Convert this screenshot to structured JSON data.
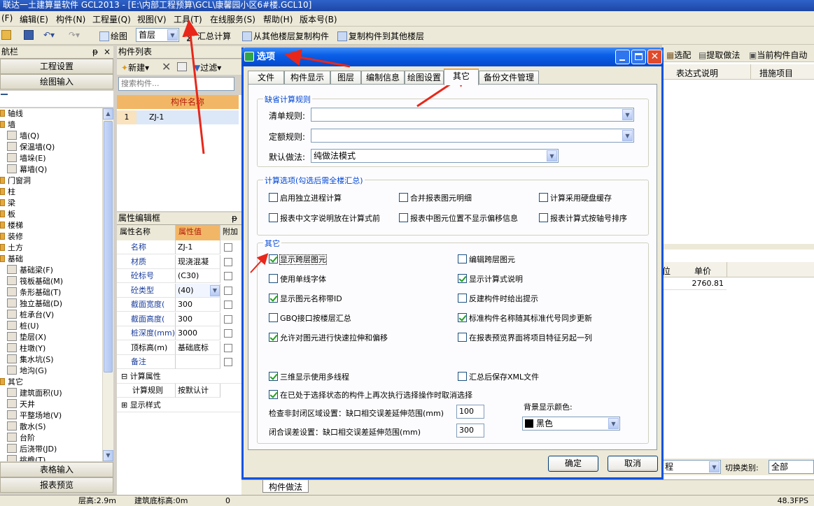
{
  "app": {
    "title": "联达一土建算量软件 GCL2013 - [E:\\内部工程预算\\GCL\\康馨园小区6#楼.GCL10]"
  },
  "menu": [
    "(F)",
    "编辑(E)",
    "构件(N)",
    "工程量(Q)",
    "视图(V)",
    "工具(T)",
    "在线服务(S)",
    "帮助(H)",
    "版本号(B)"
  ],
  "toolbar": {
    "draw_label": "绘图",
    "floor_value": "首层",
    "sum_calc": "汇总计算",
    "copy_from_floors": "从其他楼层复制构件",
    "copy_to_floors": "复制构件到其他楼层"
  },
  "nav": {
    "title": "航栏",
    "project_settings": "工程设置",
    "drawing_input": "绘图输入",
    "table_input": "表格输入",
    "report_preview": "报表预览",
    "tree": [
      {
        "label": "轴线",
        "type": "folder",
        "indent": 0
      },
      {
        "label": "墙",
        "type": "folder",
        "indent": 0
      },
      {
        "label": "墙(Q)",
        "type": "item",
        "indent": 1
      },
      {
        "label": "保温墙(Q)",
        "type": "item",
        "indent": 1
      },
      {
        "label": "墙垛(E)",
        "type": "item",
        "indent": 1
      },
      {
        "label": "幕墙(Q)",
        "type": "item",
        "indent": 1
      },
      {
        "label": "门窗洞",
        "type": "folder",
        "indent": 0
      },
      {
        "label": "柱",
        "type": "folder",
        "indent": 0
      },
      {
        "label": "梁",
        "type": "folder",
        "indent": 0
      },
      {
        "label": "板",
        "type": "folder",
        "indent": 0
      },
      {
        "label": "楼梯",
        "type": "folder",
        "indent": 0
      },
      {
        "label": "装修",
        "type": "folder",
        "indent": 0
      },
      {
        "label": "土方",
        "type": "folder",
        "indent": 0
      },
      {
        "label": "基础",
        "type": "folder",
        "indent": 0
      },
      {
        "label": "基础梁(F)",
        "type": "item",
        "indent": 1
      },
      {
        "label": "筏板基础(M)",
        "type": "item",
        "indent": 1
      },
      {
        "label": "条形基础(T)",
        "type": "item",
        "indent": 1
      },
      {
        "label": "独立基础(D)",
        "type": "item",
        "indent": 1
      },
      {
        "label": "桩承台(V)",
        "type": "item",
        "indent": 1
      },
      {
        "label": "桩(U)",
        "type": "item",
        "indent": 1
      },
      {
        "label": "垫层(X)",
        "type": "item",
        "indent": 1
      },
      {
        "label": "柱墩(Y)",
        "type": "item",
        "indent": 1
      },
      {
        "label": "集水坑(S)",
        "type": "item",
        "indent": 1
      },
      {
        "label": "地沟(G)",
        "type": "item",
        "indent": 1
      },
      {
        "label": "其它",
        "type": "folder",
        "indent": 0
      },
      {
        "label": "建筑面积(U)",
        "type": "item",
        "indent": 1
      },
      {
        "label": "天井",
        "type": "item",
        "indent": 1
      },
      {
        "label": "平整场地(V)",
        "type": "item",
        "indent": 1
      },
      {
        "label": "散水(S)",
        "type": "item",
        "indent": 1
      },
      {
        "label": "台阶",
        "type": "item",
        "indent": 1
      },
      {
        "label": "后浇带(JD)",
        "type": "item",
        "indent": 1
      },
      {
        "label": "挑檐(T)",
        "type": "item",
        "indent": 1
      }
    ]
  },
  "component_list": {
    "title": "构件列表",
    "new_label": "新建",
    "filter_label": "过滤",
    "search_placeholder": "搜索构件...",
    "column_header": "构件名称",
    "rows": [
      {
        "index": "1",
        "name": "ZJ-1"
      }
    ]
  },
  "property_editor": {
    "title": "属性编辑框",
    "col_name": "属性名称",
    "col_value": "属性值",
    "col_extra": "附加",
    "rows": [
      {
        "name": "名称",
        "value": "ZJ-1"
      },
      {
        "name": "材质",
        "value": "现浇混凝"
      },
      {
        "name": "砼标号",
        "value": "(C30)"
      },
      {
        "name": "砼类型",
        "value": "(40)"
      },
      {
        "name": "截面宽度(",
        "value": "300"
      },
      {
        "name": "截面高度(",
        "value": "300"
      },
      {
        "name": "桩深度(mm)",
        "value": "3000"
      },
      {
        "name": "顶标高(m)",
        "value": "基础底标"
      },
      {
        "name": "备注",
        "value": ""
      },
      {
        "name": "计算属性",
        "value": ""
      },
      {
        "name": "计算规则",
        "value": "按默认计"
      },
      {
        "name": "显示样式",
        "value": ""
      }
    ]
  },
  "right_panel": {
    "select_config": "选配",
    "extract_method": "提取做法",
    "auto_current": "当前构件自动",
    "col_expr_desc": "表达式说明",
    "col_measure": "措施项目",
    "col_b": "位",
    "col_unit_price": "单价",
    "unit_price_value": "2760.81",
    "bottom_combo": "程",
    "switch_label": "切换类别:",
    "switch_value": "全部",
    "bottom_tab": "构件做法"
  },
  "dialog": {
    "title": "选项",
    "tabs": [
      "文件",
      "构件显示",
      "图层",
      "编制信息",
      "绘图设置",
      "其它",
      "备份文件管理"
    ],
    "active_tab": "其它",
    "group_default_rules": "缺省计算规则",
    "list_rule_label": "清单规则:",
    "list_rule_value": "",
    "quota_rule_label": "定额规则:",
    "quota_rule_value": "",
    "default_method_label": "默认做法:",
    "default_method_value": "纯做法模式",
    "group_calc_options": "计算选项(勾选后需全楼汇总)",
    "calc_options": [
      {
        "label": "启用独立进程计算",
        "checked": false
      },
      {
        "label": "合并报表图元明细",
        "checked": false
      },
      {
        "label": "计算采用硬盘缓存",
        "checked": false
      },
      {
        "label": "报表中文字说明放在计算式前",
        "checked": false
      },
      {
        "label": "报表中图元位置不显示偏移信息",
        "checked": false
      },
      {
        "label": "报表计算式按轴号排序",
        "checked": false
      }
    ],
    "group_other": "其它",
    "other_options": [
      {
        "label": "显示跨层图元",
        "checked": true
      },
      {
        "label": "编辑跨层图元",
        "checked": false
      },
      {
        "label": "使用单线字体",
        "checked": false
      },
      {
        "label": "显示计算式说明",
        "checked": true
      },
      {
        "label": "显示图元名称带ID",
        "checked": true
      },
      {
        "label": "反建构件时给出提示",
        "checked": false
      },
      {
        "label": "GBQ接口按楼层汇总",
        "checked": false
      },
      {
        "label": "标准构件名称随其标准代号同步更新",
        "checked": true
      },
      {
        "label": "允许对图元进行快速拉伸和偏移",
        "checked": true
      },
      {
        "label": "在报表预览界面将项目特征另起一列",
        "checked": false
      },
      {
        "label": "三维显示使用多线程",
        "checked": true
      },
      {
        "label": "汇总后保存XML文件",
        "checked": false
      },
      {
        "label": "在已处于选择状态的构件上再次执行选择操作时取消选择",
        "checked": true
      }
    ],
    "check_unclosed_label": "检查非封闭区域设置：缺口相交误差延伸范围(mm)",
    "check_unclosed_value": "100",
    "close_error_label": "闭合误差设置：缺口相交误差延伸范围(mm)",
    "close_error_value": "300",
    "bg_color_label": "背景显示颜色:",
    "bg_color_value": "黑色",
    "ok_label": "确定",
    "cancel_label": "取消"
  },
  "statusbar": {
    "floor_height": "层高:2.9m",
    "base_elevation": "建筑底标高:0m",
    "value": "0",
    "fps": "48.3FPS"
  },
  "colors": {
    "accent_red": "#e8271a",
    "dialog_blue": "#0a53e0",
    "grid_header": "#f2b766"
  }
}
